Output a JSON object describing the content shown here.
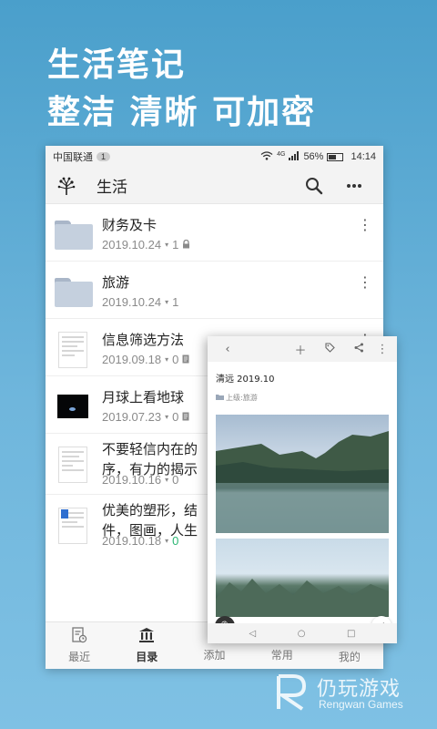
{
  "promo": {
    "line1": "生活笔记",
    "line2": "整洁 清晰 可加密"
  },
  "status": {
    "carrier": "中国联通",
    "sim": "1",
    "network": "4G",
    "battery": "56%",
    "battery_level": 0.56,
    "time": "14:14"
  },
  "appbar": {
    "title": "生活",
    "icons": [
      "tree-logo-icon",
      "search-icon",
      "more-icon"
    ]
  },
  "notes": [
    {
      "name": "财务及卡",
      "date": "2019.10.24",
      "count": "1",
      "thumb": "folder",
      "locked": true
    },
    {
      "name": "旅游",
      "date": "2019.10.24",
      "count": "1",
      "thumb": "folder",
      "locked": false
    },
    {
      "name": "信息筛选方法",
      "date": "2019.09.18",
      "count": "0",
      "thumb": "document"
    },
    {
      "name": "月球上看地球",
      "date": "2019.07.23",
      "count": "0",
      "thumb": "moon-photo"
    },
    {
      "name": "不要轻信内在的",
      "name2": "序，有力的揭示",
      "date": "2019.10.16",
      "count": "0",
      "thumb": "document"
    },
    {
      "name": "优美的塑形，结",
      "name2": "件，图画，人生",
      "date": "2019.10.18",
      "count": "0",
      "thumb": "document-bookmarked"
    }
  ],
  "bottom_nav": [
    {
      "label": "最近",
      "icon": "recent-icon"
    },
    {
      "label": "目录",
      "icon": "catalog-icon",
      "active": true
    },
    {
      "label": "添加",
      "icon": "add-icon"
    },
    {
      "label": "常用",
      "icon": "favorite-icon"
    },
    {
      "label": "我的",
      "icon": "profile-icon"
    }
  ],
  "note_card": {
    "title": "清远 2019.10",
    "folder": "上级:旅游",
    "toolbar_icons": [
      "back-icon",
      "add-icon",
      "tag-icon",
      "share-icon",
      "more-icon"
    ]
  },
  "watermark": {
    "cn": "仍玩游戏",
    "en": "Rengwan Games"
  },
  "colors": {
    "background": "#5aa9d4",
    "accent_green": "#2bb673"
  }
}
